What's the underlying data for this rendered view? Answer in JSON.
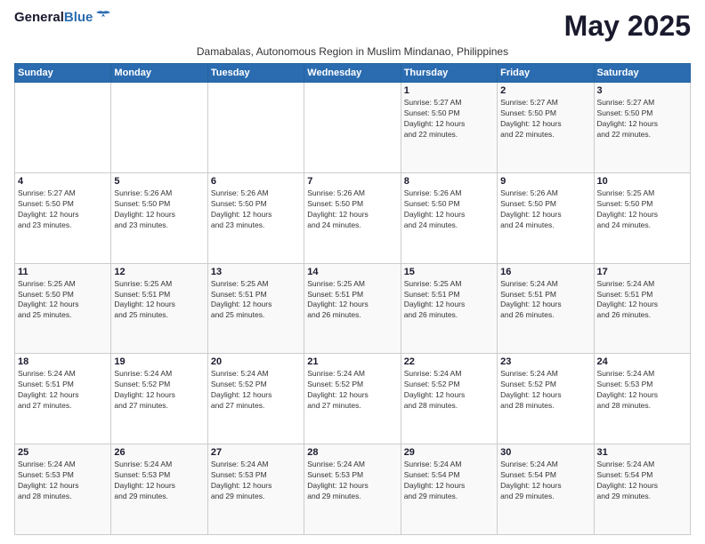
{
  "logo": {
    "line1": "General",
    "line2": "Blue"
  },
  "title": "May 2025",
  "subtitle": "Damabalas, Autonomous Region in Muslim Mindanao, Philippines",
  "days_header": [
    "Sunday",
    "Monday",
    "Tuesday",
    "Wednesday",
    "Thursday",
    "Friday",
    "Saturday"
  ],
  "weeks": [
    [
      {
        "day": "",
        "info": ""
      },
      {
        "day": "",
        "info": ""
      },
      {
        "day": "",
        "info": ""
      },
      {
        "day": "",
        "info": ""
      },
      {
        "day": "1",
        "info": "Sunrise: 5:27 AM\nSunset: 5:50 PM\nDaylight: 12 hours\nand 22 minutes."
      },
      {
        "day": "2",
        "info": "Sunrise: 5:27 AM\nSunset: 5:50 PM\nDaylight: 12 hours\nand 22 minutes."
      },
      {
        "day": "3",
        "info": "Sunrise: 5:27 AM\nSunset: 5:50 PM\nDaylight: 12 hours\nand 22 minutes."
      }
    ],
    [
      {
        "day": "4",
        "info": "Sunrise: 5:27 AM\nSunset: 5:50 PM\nDaylight: 12 hours\nand 23 minutes."
      },
      {
        "day": "5",
        "info": "Sunrise: 5:26 AM\nSunset: 5:50 PM\nDaylight: 12 hours\nand 23 minutes."
      },
      {
        "day": "6",
        "info": "Sunrise: 5:26 AM\nSunset: 5:50 PM\nDaylight: 12 hours\nand 23 minutes."
      },
      {
        "day": "7",
        "info": "Sunrise: 5:26 AM\nSunset: 5:50 PM\nDaylight: 12 hours\nand 24 minutes."
      },
      {
        "day": "8",
        "info": "Sunrise: 5:26 AM\nSunset: 5:50 PM\nDaylight: 12 hours\nand 24 minutes."
      },
      {
        "day": "9",
        "info": "Sunrise: 5:26 AM\nSunset: 5:50 PM\nDaylight: 12 hours\nand 24 minutes."
      },
      {
        "day": "10",
        "info": "Sunrise: 5:25 AM\nSunset: 5:50 PM\nDaylight: 12 hours\nand 24 minutes."
      }
    ],
    [
      {
        "day": "11",
        "info": "Sunrise: 5:25 AM\nSunset: 5:50 PM\nDaylight: 12 hours\nand 25 minutes."
      },
      {
        "day": "12",
        "info": "Sunrise: 5:25 AM\nSunset: 5:51 PM\nDaylight: 12 hours\nand 25 minutes."
      },
      {
        "day": "13",
        "info": "Sunrise: 5:25 AM\nSunset: 5:51 PM\nDaylight: 12 hours\nand 25 minutes."
      },
      {
        "day": "14",
        "info": "Sunrise: 5:25 AM\nSunset: 5:51 PM\nDaylight: 12 hours\nand 26 minutes."
      },
      {
        "day": "15",
        "info": "Sunrise: 5:25 AM\nSunset: 5:51 PM\nDaylight: 12 hours\nand 26 minutes."
      },
      {
        "day": "16",
        "info": "Sunrise: 5:24 AM\nSunset: 5:51 PM\nDaylight: 12 hours\nand 26 minutes."
      },
      {
        "day": "17",
        "info": "Sunrise: 5:24 AM\nSunset: 5:51 PM\nDaylight: 12 hours\nand 26 minutes."
      }
    ],
    [
      {
        "day": "18",
        "info": "Sunrise: 5:24 AM\nSunset: 5:51 PM\nDaylight: 12 hours\nand 27 minutes."
      },
      {
        "day": "19",
        "info": "Sunrise: 5:24 AM\nSunset: 5:52 PM\nDaylight: 12 hours\nand 27 minutes."
      },
      {
        "day": "20",
        "info": "Sunrise: 5:24 AM\nSunset: 5:52 PM\nDaylight: 12 hours\nand 27 minutes."
      },
      {
        "day": "21",
        "info": "Sunrise: 5:24 AM\nSunset: 5:52 PM\nDaylight: 12 hours\nand 27 minutes."
      },
      {
        "day": "22",
        "info": "Sunrise: 5:24 AM\nSunset: 5:52 PM\nDaylight: 12 hours\nand 28 minutes."
      },
      {
        "day": "23",
        "info": "Sunrise: 5:24 AM\nSunset: 5:52 PM\nDaylight: 12 hours\nand 28 minutes."
      },
      {
        "day": "24",
        "info": "Sunrise: 5:24 AM\nSunset: 5:53 PM\nDaylight: 12 hours\nand 28 minutes."
      }
    ],
    [
      {
        "day": "25",
        "info": "Sunrise: 5:24 AM\nSunset: 5:53 PM\nDaylight: 12 hours\nand 28 minutes."
      },
      {
        "day": "26",
        "info": "Sunrise: 5:24 AM\nSunset: 5:53 PM\nDaylight: 12 hours\nand 29 minutes."
      },
      {
        "day": "27",
        "info": "Sunrise: 5:24 AM\nSunset: 5:53 PM\nDaylight: 12 hours\nand 29 minutes."
      },
      {
        "day": "28",
        "info": "Sunrise: 5:24 AM\nSunset: 5:53 PM\nDaylight: 12 hours\nand 29 minutes."
      },
      {
        "day": "29",
        "info": "Sunrise: 5:24 AM\nSunset: 5:54 PM\nDaylight: 12 hours\nand 29 minutes."
      },
      {
        "day": "30",
        "info": "Sunrise: 5:24 AM\nSunset: 5:54 PM\nDaylight: 12 hours\nand 29 minutes."
      },
      {
        "day": "31",
        "info": "Sunrise: 5:24 AM\nSunset: 5:54 PM\nDaylight: 12 hours\nand 29 minutes."
      }
    ]
  ]
}
